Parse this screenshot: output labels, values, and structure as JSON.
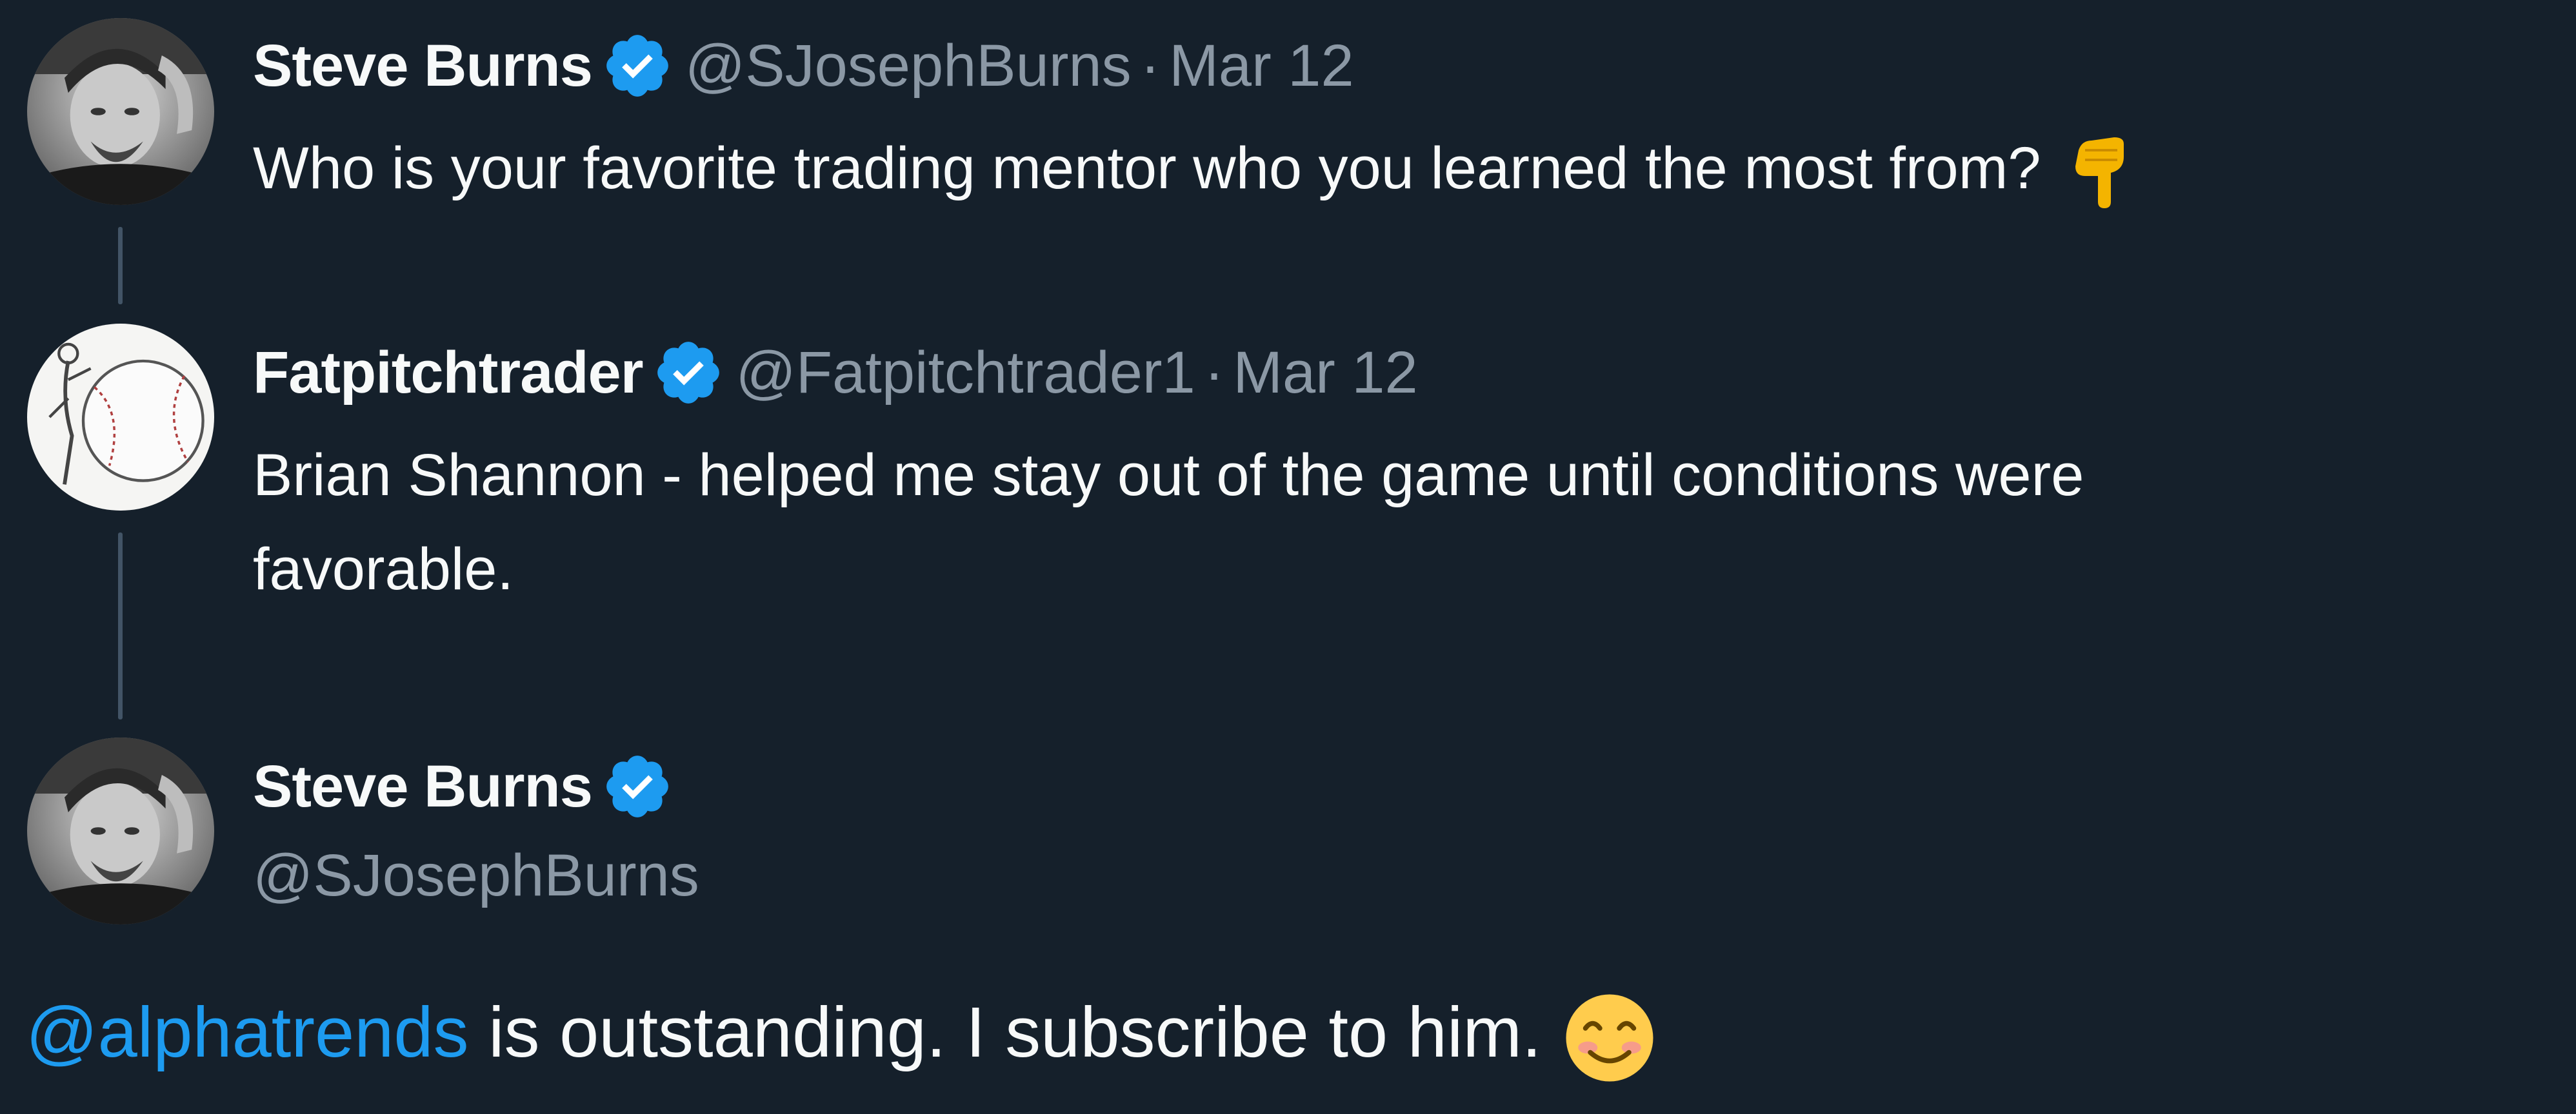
{
  "colors": {
    "background": "#15202b",
    "text_primary": "#f7f9f9",
    "text_secondary": "#8b98a5",
    "accent": "#1d9bf0",
    "thread_line": "#425466"
  },
  "tweet1": {
    "name": "Steve Burns",
    "verified_icon": "verified-badge-icon",
    "handle": "@SJosephBurns",
    "separator": "·",
    "date": "Mar 12",
    "text": "Who is your favorite trading mentor who you learned the most from?",
    "emoji": "pointing-down-hand-emoji"
  },
  "tweet2": {
    "name": "Fatpitchtrader",
    "verified_icon": "verified-badge-icon",
    "handle": "@Fatpitchtrader1",
    "separator": "·",
    "date": "Mar 12",
    "text_line1": "Brian Shannon - helped me stay out of the game until conditions were",
    "text_line2": "favorable."
  },
  "tweet3": {
    "name": "Steve Burns",
    "verified_icon": "verified-badge-icon",
    "handle": "@SJosephBurns",
    "mention": "@alphatrends",
    "text": " is outstanding. I subscribe to him. ",
    "emoji": "smiling-face-emoji"
  }
}
